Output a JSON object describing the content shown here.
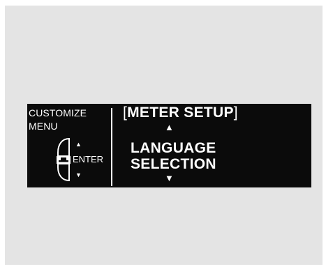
{
  "sidebar": {
    "title": "CUSTOMIZE\nMENU",
    "up_arrow": "▲",
    "down_arrow": "▼",
    "enter_label": "ENTER",
    "knob_icon": "selector-knob-icon"
  },
  "main": {
    "bracket_open": "[",
    "header": "METER SETUP",
    "bracket_close": "]",
    "up_arrow": "▲",
    "selected_item": "LANGUAGE\nSELECTION",
    "down_arrow": "▼"
  },
  "colors": {
    "display_bg": "#0b0b0b",
    "display_text": "#ffffff",
    "panel_bg": "#e4e4e4"
  }
}
